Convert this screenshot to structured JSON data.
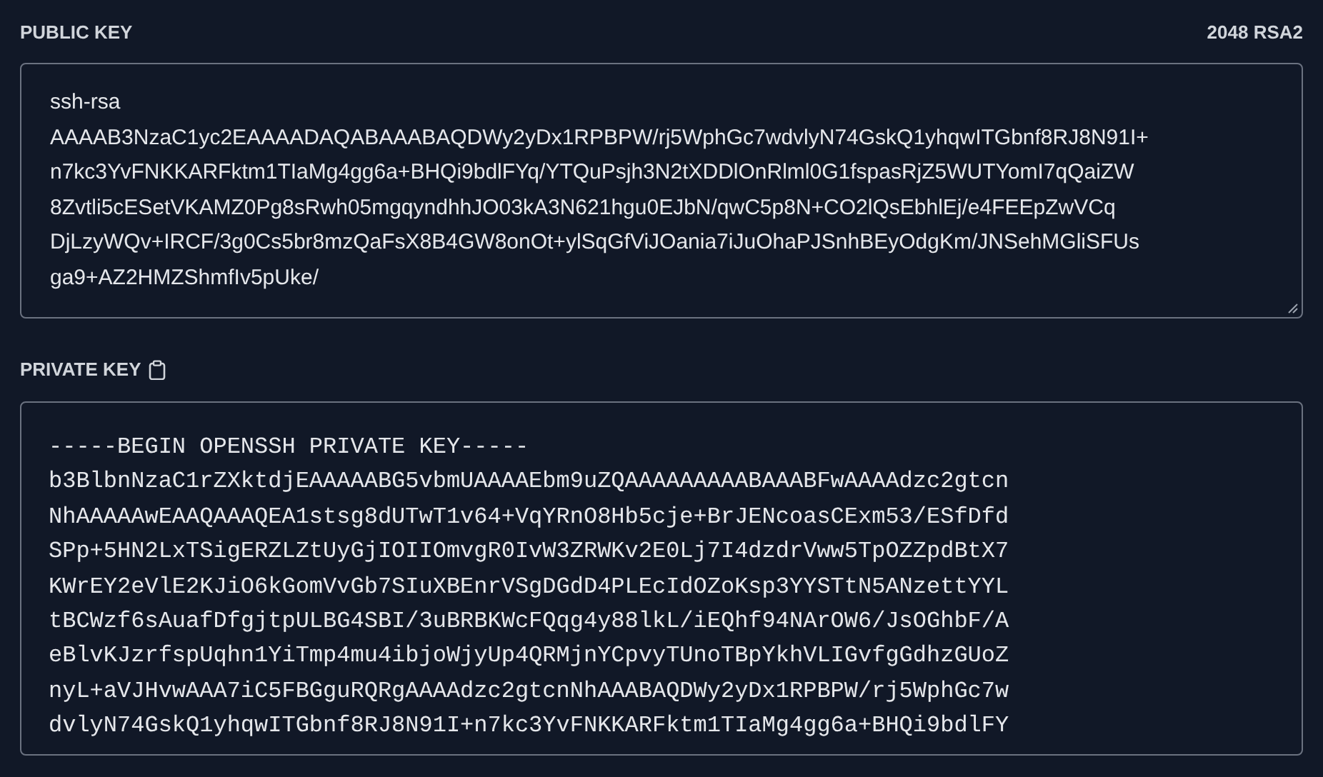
{
  "public_key": {
    "label": "PUBLIC KEY",
    "meta": "2048 RSA2",
    "lines": [
      "ssh-rsa",
      "AAAAB3NzaC1yc2EAAAADAQABAAABAQDWy2yDx1RPBPW/rj5WphGc7wdvlyN74GskQ1yhqwITGbnf8RJ8N91I+",
      "n7kc3YvFNKKARFktm1TIaMg4gg6a+BHQi9bdlFYq/YTQuPsjh3N2tXDDlOnRlml0G1fspasRjZ5WUTYomI7qQaiZW",
      "8Zvtli5cESetVKAMZ0Pg8sRwh05mgqyndhhJO03kA3N621hgu0EJbN/qwC5p8N+CO2lQsEbhlEj/e4FEEpZwVCq",
      "DjLzyWQv+IRCF/3g0Cs5br8mzQaFsX8B4GW8onOt+ylSqGfViJOania7iJuOhaPJSnhBEyOdgKm/JNSehMGliSFUs",
      "ga9+AZ2HMZShmfIv5pUke/"
    ]
  },
  "private_key": {
    "label": "PRIVATE KEY",
    "lines": [
      "-----BEGIN OPENSSH PRIVATE KEY-----",
      "b3BlbnNzaC1rZXktdjEAAAAABG5vbmUAAAAEbm9uZQAAAAAAAAABAAABFwAAAAdzc2gtcn",
      "NhAAAAAwEAAQAAAQEA1stsg8dUTwT1v64+VqYRnO8Hb5cje+BrJENcoasCExm53/ESfDfd",
      "SPp+5HN2LxTSigERZLZtUyGjIOIIOmvgR0IvW3ZRWKv2E0Lj7I4dzdrVww5TpOZZpdBtX7",
      "KWrEY2eVlE2KJiO6kGomVvGb7SIuXBEnrVSgDGdD4PLEcIdOZoKsp3YYSTtN5ANzettYYL",
      "tBCWzf6sAuafDfgjtpULBG4SBI/3uBRBKWcFQqg4y88lkL/iEQhf94NArOW6/JsOGhbF/A",
      "eBlvKJzrfspUqhn1YiTmp4mu4ibjoWjyUp4QRMjnYCpvyTUnoTBpYkhVLIGvfgGdhzGUoZ",
      "nyL+aVJHvwAAA7iC5FBGguRQRgAAAAdzc2gtcnNhAAABAQDWy2yDx1RPBPW/rj5WphGc7w",
      "dvlyN74GskQ1yhqwITGbnf8RJ8N91I+n7kc3YvFNKKARFktm1TIaMg4gg6a+BHQi9bdlFY"
    ]
  }
}
